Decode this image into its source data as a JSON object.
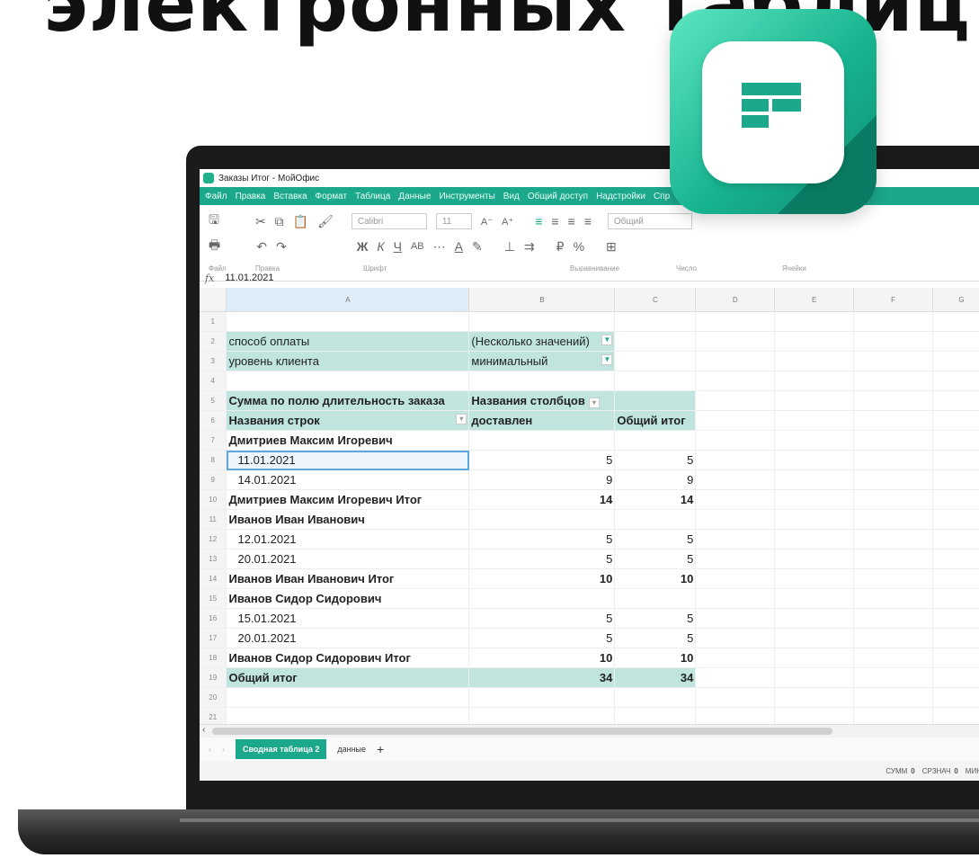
{
  "headline": "электронных таблиц",
  "window": {
    "title": "Заказы Итог - МойОфис"
  },
  "menu": [
    "Файл",
    "Правка",
    "Вставка",
    "Формат",
    "Таблица",
    "Данные",
    "Инструменты",
    "Вид",
    "Общий доступ",
    "Надстройки",
    "Спр"
  ],
  "ribbon": {
    "font_name": "Calibri",
    "font_size": "11",
    "number_format": "Общий",
    "groups": [
      "Файл",
      "Правка",
      "Шрифт",
      "Выравнивание",
      "Число",
      "Ячейки"
    ]
  },
  "formula_bar": {
    "fx": "fx",
    "value": "11.01.2021"
  },
  "columns": [
    "A",
    "B",
    "C",
    "D",
    "E",
    "F",
    "G"
  ],
  "rows": [
    {
      "n": "1",
      "a": "",
      "b": "",
      "c": ""
    },
    {
      "n": "2",
      "a": "способ оплаты",
      "b": "(Несколько значений)",
      "c": ""
    },
    {
      "n": "3",
      "a": "уровень клиента",
      "b": "минимальный",
      "c": ""
    },
    {
      "n": "4",
      "a": "",
      "b": "",
      "c": ""
    },
    {
      "n": "5",
      "a": "Сумма по полю длительность заказа",
      "b": "Названия столбцов",
      "c": ""
    },
    {
      "n": "6",
      "a": "Названия строк",
      "b": "доставлен",
      "c": "Общий итог"
    },
    {
      "n": "7",
      "a": "Дмитриев Максим Игоревич",
      "b": "",
      "c": ""
    },
    {
      "n": "8",
      "a": "11.01.2021",
      "b": "5",
      "c": "5"
    },
    {
      "n": "9",
      "a": "14.01.2021",
      "b": "9",
      "c": "9"
    },
    {
      "n": "10",
      "a": "Дмитриев Максим Игоревич Итог",
      "b": "14",
      "c": "14"
    },
    {
      "n": "11",
      "a": "Иванов Иван Иванович",
      "b": "",
      "c": ""
    },
    {
      "n": "12",
      "a": "12.01.2021",
      "b": "5",
      "c": "5"
    },
    {
      "n": "13",
      "a": "20.01.2021",
      "b": "5",
      "c": "5"
    },
    {
      "n": "14",
      "a": "Иванов Иван Иванович Итог",
      "b": "10",
      "c": "10"
    },
    {
      "n": "15",
      "a": "Иванов Сидор Сидорович",
      "b": "",
      "c": ""
    },
    {
      "n": "16",
      "a": "15.01.2021",
      "b": "5",
      "c": "5"
    },
    {
      "n": "17",
      "a": "20.01.2021",
      "b": "5",
      "c": "5"
    },
    {
      "n": "18",
      "a": "Иванов Сидор Сидорович Итог",
      "b": "10",
      "c": "10"
    },
    {
      "n": "19",
      "a": "Общий итог",
      "b": "34",
      "c": "34"
    },
    {
      "n": "20",
      "a": "",
      "b": "",
      "c": ""
    },
    {
      "n": "21",
      "a": "",
      "b": "",
      "c": ""
    }
  ],
  "sheets": {
    "active": "Сводная таблица 2",
    "other": "данные",
    "add": "+"
  },
  "status": {
    "sum_label": "СУММ",
    "sum": "0",
    "avg_label": "СРЗНАЧ",
    "avg": "0",
    "min_label": "МИН"
  }
}
